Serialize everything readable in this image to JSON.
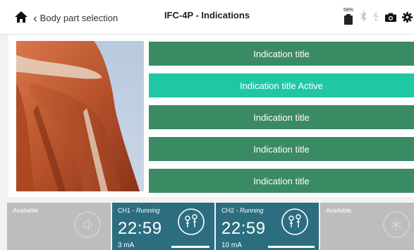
{
  "topbar": {
    "back_label": "Body part selection",
    "title": "IFC-4P - Indications",
    "battery_percent": "58%"
  },
  "image": {
    "alt": "Shoulder muscle anatomy"
  },
  "indications": [
    {
      "label": "Indication title",
      "active": false
    },
    {
      "label": "Indication title Active",
      "active": true
    },
    {
      "label": "Indication title",
      "active": false
    },
    {
      "label": "Indication title",
      "active": false
    },
    {
      "label": "Indication title",
      "active": false
    }
  ],
  "channels": [
    {
      "status": "Available"
    },
    {
      "name": "CH1",
      "status": "Running",
      "time": "22:59",
      "current": "3 mA"
    },
    {
      "name": "CH2",
      "status": "Running",
      "time": "22:59",
      "current": "10 mA"
    },
    {
      "status": "Available"
    }
  ],
  "colors": {
    "indication": "#3a8a64",
    "indication_active": "#1fc8a3",
    "channel_running": "#2c6e80",
    "channel_available": "#bdbdbd"
  }
}
